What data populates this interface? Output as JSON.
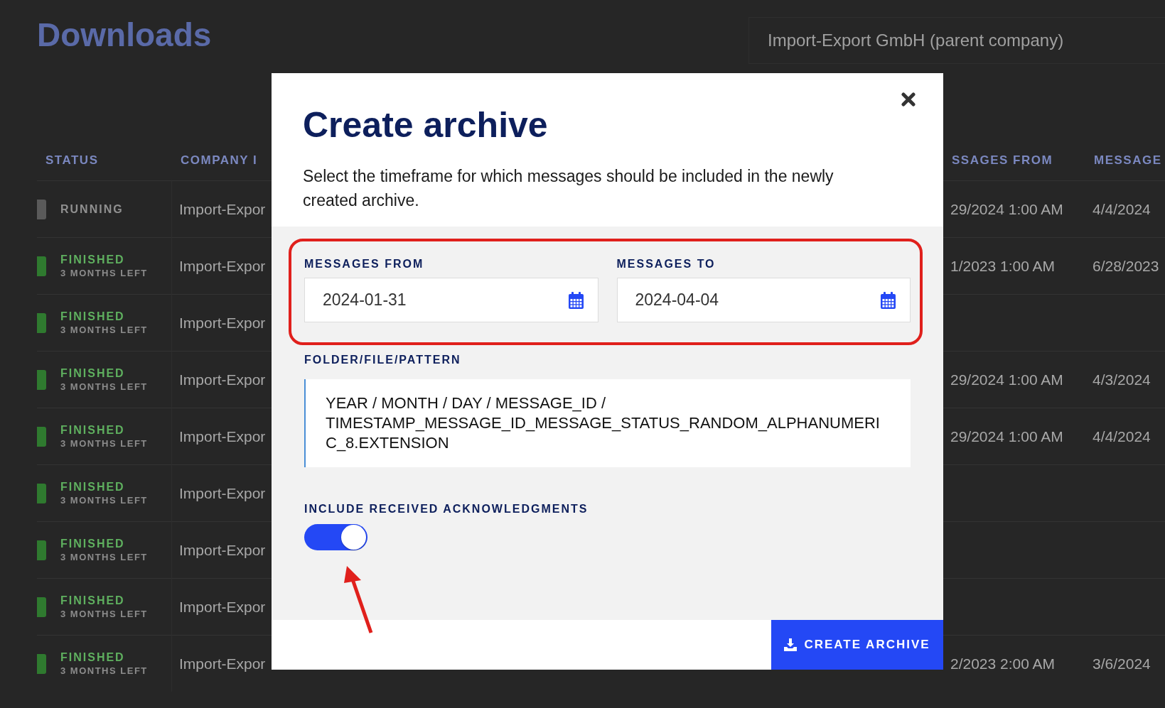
{
  "page": {
    "title": "Downloads",
    "company_select": "Import-Export GmbH (parent company)"
  },
  "table": {
    "columns": [
      "STATUS",
      "COMPANY I",
      "SSAGES FROM",
      "MESSAGE"
    ],
    "rows": [
      {
        "kind": "running",
        "status": "RUNNING",
        "company": "Import-Expor",
        "column_3": "29/2024 1:00 AM",
        "column_4": "4/4/2024"
      },
      {
        "kind": "finished",
        "status": "FINISHED",
        "note": "3 MONTHS LEFT",
        "company": "Import-Expor",
        "column_3": "1/2023 1:00 AM",
        "column_4": "6/28/2023"
      },
      {
        "kind": "finished",
        "status": "FINISHED",
        "note": "3 MONTHS LEFT",
        "company": "Import-Expor"
      },
      {
        "kind": "finished",
        "status": "FINISHED",
        "note": "3 MONTHS LEFT",
        "company": "Import-Expor",
        "column_3": "29/2024 1:00 AM",
        "column_4": "4/3/2024"
      },
      {
        "kind": "finished",
        "status": "FINISHED",
        "note": "3 MONTHS LEFT",
        "company": "Import-Expor",
        "column_3": "29/2024 1:00 AM",
        "column_4": "4/4/2024"
      },
      {
        "kind": "finished",
        "status": "FINISHED",
        "note": "3 MONTHS LEFT",
        "company": "Import-Expor"
      },
      {
        "kind": "finished",
        "status": "FINISHED",
        "note": "3 MONTHS LEFT",
        "company": "Import-Expor"
      },
      {
        "kind": "finished",
        "status": "FINISHED",
        "note": "3 MONTHS LEFT",
        "company": "Import-Expor"
      },
      {
        "kind": "finished",
        "status": "FINISHED",
        "note": "3 MONTHS LEFT",
        "company": "Import-Expor",
        "column_3": "2/2023 2:00 AM",
        "column_4": "3/6/2024"
      }
    ]
  },
  "dialog": {
    "title": "Create archive",
    "description": "Select the timeframe for which messages should be included in the newly created archive.",
    "messages_from": {
      "label": "MESSAGES FROM",
      "value": "2024-01-31"
    },
    "messages_to": {
      "label": "MESSAGES TO",
      "value": "2024-04-04"
    },
    "pattern": {
      "label": "FOLDER/FILE/PATTERN",
      "value": "YEAR / MONTH / DAY / MESSAGE_ID / TIMESTAMP_MESSAGE_ID_MESSAGE_STATUS_RANDOM_ALPHANUMERIC_8.EXTENSION"
    },
    "acknowledgments": {
      "label": "INCLUDE RECEIVED ACKNOWLEDGMENTS",
      "on": true
    },
    "button": "CREATE ARCHIVE"
  }
}
